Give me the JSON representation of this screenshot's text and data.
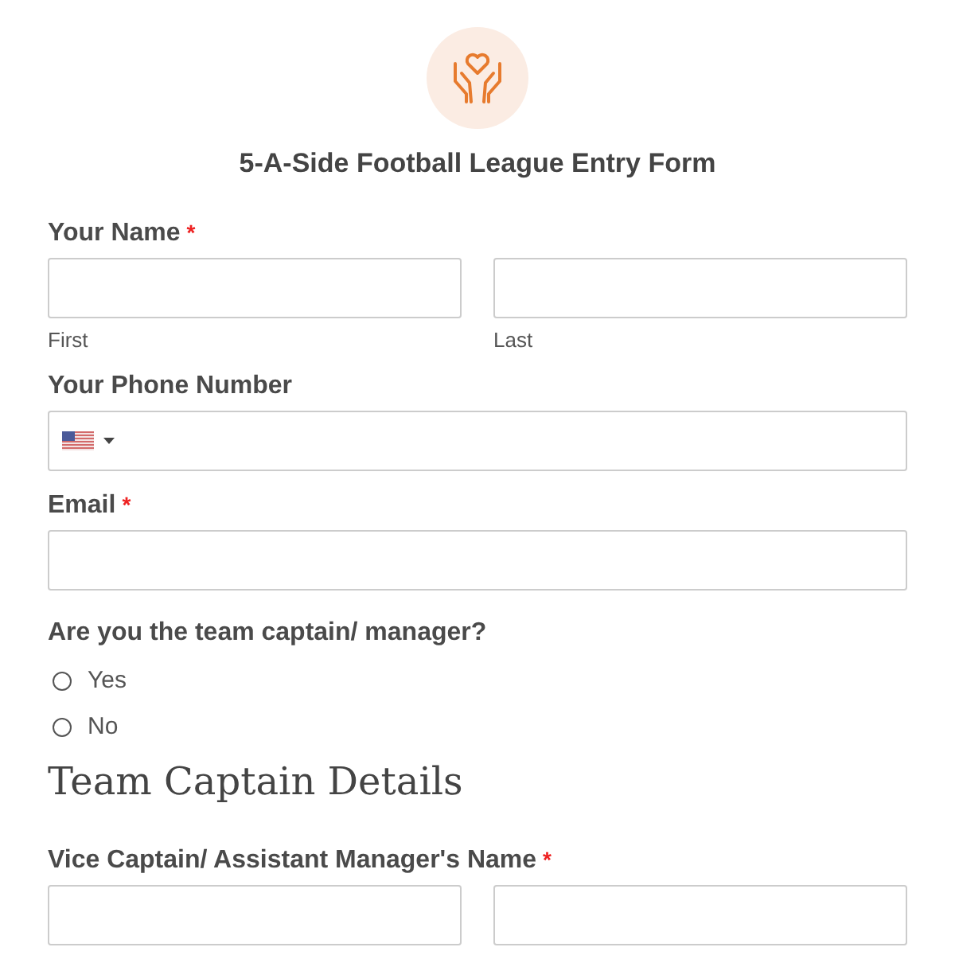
{
  "title": "5-A-Side Football League Entry Form",
  "fields": [
    {
      "kind": "name",
      "label": "Your Name",
      "required_mark": "*",
      "sublabels": [
        "First",
        "Last"
      ]
    },
    {
      "kind": "phone",
      "label": "Your Phone Number"
    },
    {
      "kind": "text",
      "label": "Email",
      "required_mark": "*"
    },
    {
      "kind": "radio",
      "label": "Are you the team captain/ manager?",
      "options": [
        {
          "label": "Yes",
          "selected": false
        },
        {
          "label": "No",
          "selected": false
        }
      ]
    },
    {
      "kind": "heading",
      "label": "Team Captain Details"
    },
    {
      "kind": "name",
      "label": "Vice Captain/ Assistant Manager's Name",
      "required_mark": "*"
    }
  ]
}
